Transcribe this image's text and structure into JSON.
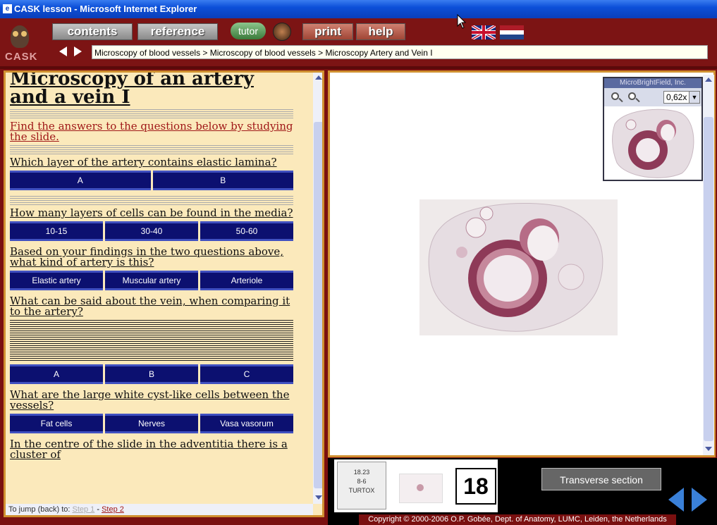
{
  "window": {
    "title": "CASK lesson - Microsoft Internet Explorer"
  },
  "toolbar": {
    "logo_text": "CASK",
    "contents_label": "contents",
    "reference_label": "reference",
    "tutor_label": "tutor",
    "print_label": "print",
    "help_label": "help"
  },
  "breadcrumb": {
    "text": "Microscopy of blood vessels > Microscopy of blood vessels > Microscopy Artery and Vein I"
  },
  "lesson": {
    "title": "Microscopy of an artery and a vein I",
    "intro": "Find the answers to the questions below by studying the slide.",
    "q1": "Which layer of the artery contains elastic lamina?",
    "q1_answers": [
      "A",
      "B"
    ],
    "q2": "How many layers of cells can be found in the media?",
    "q2_answers": [
      "10-15",
      "30-40",
      "50-60"
    ],
    "q3": "Based on your findings in the two questions above, what kind of artery is this?",
    "q3_answers": [
      "Elastic artery",
      "Muscular artery",
      "Arteriole"
    ],
    "q4": "What can be said about the vein, when comparing it to the artery?",
    "q4_answers": [
      "A",
      "B",
      "C"
    ],
    "q5": "What are the large white cyst-like cells between the vessels?",
    "q5_answers": [
      "Fat cells",
      "Nerves",
      "Vasa vasorum"
    ],
    "q6": "In the centre of the slide in the adventitia there is a cluster of"
  },
  "jump": {
    "label": "To jump (back) to:",
    "step1": "Step 1",
    "sep": " - ",
    "step2": "Step 2"
  },
  "navigator": {
    "brand": "MicroBrightField, Inc.",
    "zoom": "0,62x"
  },
  "slide": {
    "label_lines": [
      "18.23",
      "8-6",
      "TURTOX"
    ],
    "number": "18"
  },
  "footer": {
    "transverse_label": "Transverse section",
    "copyright": "Copyright © 2000-2006 O.P. Gobée, Dept. of Anatomy, LUMC, Leiden, the Netherlands"
  }
}
